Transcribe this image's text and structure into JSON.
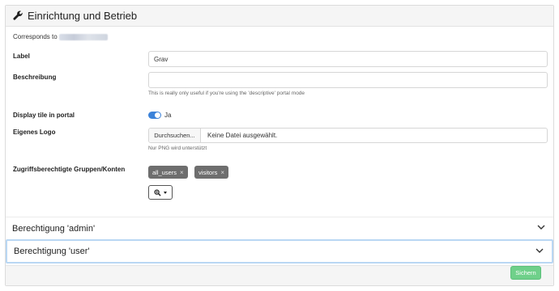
{
  "header": {
    "title": "Einrichtung und Betrieb",
    "icon": "wrench-icon"
  },
  "corresponds": {
    "prefix": "Corresponds to"
  },
  "fields": {
    "label": {
      "label": "Label",
      "value": "Grav"
    },
    "description": {
      "label": "Beschreibung",
      "value": "",
      "help": "This is really only useful if you're using the 'descriptive' portal mode"
    },
    "display_tile": {
      "label": "Display tile in portal",
      "checked": true,
      "text": "Ja"
    },
    "logo": {
      "label": "Eigenes Logo",
      "button": "Durchsuchen...",
      "filename": "Keine Datei ausgewählt.",
      "help": "Nur PNG wird unterstützt"
    },
    "groups": {
      "label": "Zugriffsberechtigte Gruppen/Konten",
      "chips": [
        "all_users",
        "visitors"
      ]
    }
  },
  "accordion": {
    "admin": {
      "title": "Berechtigung 'admin'"
    },
    "user": {
      "title": "Berechtigung 'user'"
    }
  },
  "footer": {
    "save_label": "Sichern"
  },
  "colors": {
    "toggle": "#3b82d9",
    "save": "#6fd08a",
    "chip": "#6e6e6e",
    "focus": "#b9d7f3"
  }
}
